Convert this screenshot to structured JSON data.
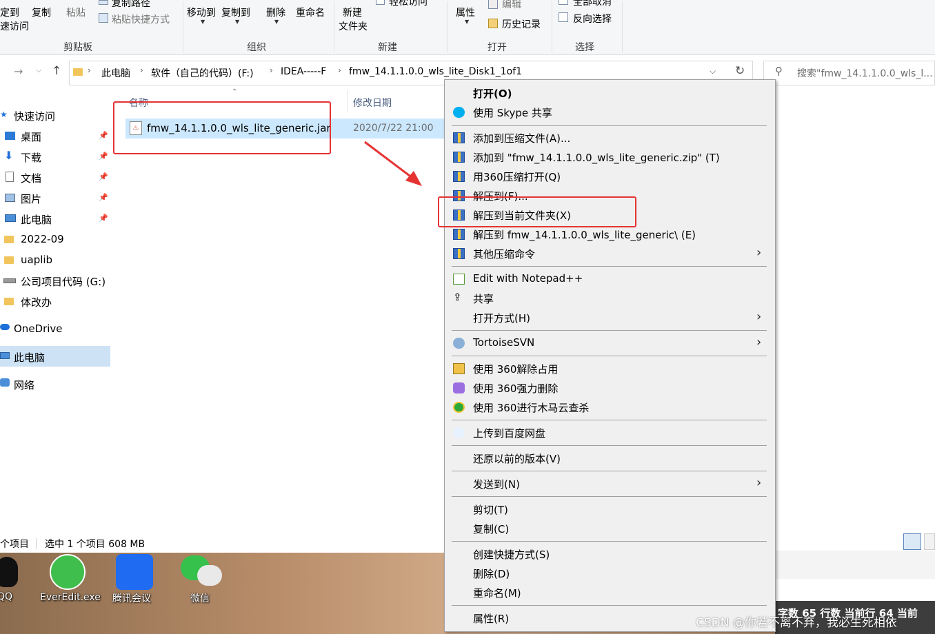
{
  "ribbon": {
    "pin_quick_access": "定到",
    "quick_access_2": "速访问",
    "copy": "复制",
    "paste": "粘贴",
    "copy_path": "复制路径",
    "paste_shortcut": "粘贴快捷方式",
    "clipboard_group": "剪贴板",
    "move_to": "移动到",
    "copy_to": "复制到",
    "delete": "删除",
    "rename": "重命名",
    "organize_group": "组织",
    "new_folder_line1": "新建",
    "new_folder_line2": "文件夹",
    "easy_access": "轻松访问",
    "new_group": "新建",
    "properties": "属性",
    "edit": "编辑",
    "history": "历史记录",
    "open_group": "打开",
    "select_none": "全部取消",
    "invert_selection": "反向选择",
    "select_group": "选择"
  },
  "address": {
    "crumbs": [
      "此电脑",
      "软件（自己的代码）(F:)",
      "IDEA-----F",
      "fmw_14.1.1.0.0_wls_lite_Disk1_1of1"
    ],
    "search_placeholder": "搜索\"fmw_14.1.1.0.0_wls_l..."
  },
  "sidebar": {
    "quick_access": "快速访问",
    "items": [
      {
        "label": "桌面"
      },
      {
        "label": "下载"
      },
      {
        "label": "文档"
      },
      {
        "label": "图片"
      },
      {
        "label": "此电脑"
      },
      {
        "label": "2022-09"
      },
      {
        "label": "uaplib"
      },
      {
        "label": "公司项目代码 (G:)"
      },
      {
        "label": "体改办"
      }
    ],
    "onedrive": "OneDrive",
    "this_pc": "此电脑",
    "network": "网络"
  },
  "filelist": {
    "col_name": "名称",
    "col_modified": "修改日期",
    "file_name": "fmw_14.1.1.0.0_wls_lite_generic.jar",
    "file_date": "2020/7/22 21:00"
  },
  "status": {
    "count": "个项目",
    "selected": "选中 1 个项目  608 MB"
  },
  "desktop": {
    "icons": [
      {
        "label": "QQ"
      },
      {
        "label": "EverEdit.exe"
      },
      {
        "label": "腾讯会议"
      },
      {
        "label": "微信"
      }
    ],
    "editor_status": "字数  65 行数  当前行 64  当前",
    "watermark": "CSDN @你若不离不弃，我必生死相依"
  },
  "context_menu": {
    "open": "打开(O)",
    "skype": "使用 Skype 共享",
    "add_archive": "添加到压缩文件(A)...",
    "add_zip": "添加到 \"fmw_14.1.1.0.0_wls_lite_generic.zip\" (T)",
    "open_360": "用360压缩打开(Q)",
    "extract_to": "解压到(F)...",
    "extract_here": "解压到当前文件夹(X)",
    "extract_folder": "解压到 fmw_14.1.1.0.0_wls_lite_generic\\ (E)",
    "other_zip": "其他压缩命令",
    "notepad": "Edit with Notepad++",
    "share": "共享",
    "open_with": "打开方式(H)",
    "svn": "TortoiseSVN",
    "unlock_360": "使用 360解除占用",
    "force_delete_360": "使用 360强力删除",
    "scan_360": "使用 360进行木马云查杀",
    "baidu": "上传到百度网盘",
    "restore": "还原以前的版本(V)",
    "send_to": "发送到(N)",
    "cut": "剪切(T)",
    "copy": "复制(C)",
    "shortcut": "创建快捷方式(S)",
    "delete": "删除(D)",
    "rename": "重命名(M)",
    "properties": "属性(R)"
  }
}
